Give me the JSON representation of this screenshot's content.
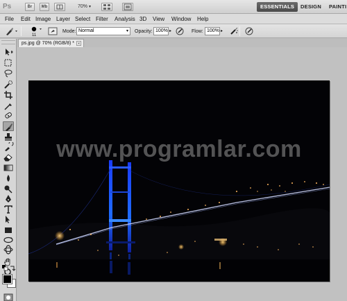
{
  "appbar": {
    "logo": "Ps",
    "br_label": "Br",
    "mb_label": "Mb",
    "zoom": "70%",
    "workspaces": [
      "ESSENTIALS",
      "DESIGN",
      "PAINTI"
    ]
  },
  "menu": [
    "File",
    "Edit",
    "Image",
    "Layer",
    "Select",
    "Filter",
    "Analysis",
    "3D",
    "View",
    "Window",
    "Help"
  ],
  "options": {
    "brush_size": "11",
    "mode_label": "Mode:",
    "mode_value": "Normal",
    "opacity_label": "Opacity:",
    "opacity_value": "100%",
    "flow_label": "Flow:",
    "flow_value": "100%"
  },
  "document": {
    "tab_title": "ps.jpg @ 70% (RGB/8) *",
    "close_glyph": "×"
  },
  "canvas": {
    "watermark": "www.programlar.com"
  },
  "icons": [
    "move-tool-icon",
    "marquee-tool-icon",
    "lasso-tool-icon",
    "quick-selection-tool-icon",
    "crop-tool-icon",
    "eyedropper-tool-icon",
    "healing-brush-tool-icon",
    "brush-tool-icon",
    "clone-stamp-tool-icon",
    "history-brush-tool-icon",
    "eraser-tool-icon",
    "gradient-tool-icon",
    "blur-tool-icon",
    "dodge-tool-icon",
    "pen-tool-icon",
    "type-tool-icon",
    "path-selection-tool-icon",
    "rectangle-tool-icon",
    "3d-rotate-tool-icon",
    "3d-orbit-tool-icon",
    "hand-tool-icon",
    "zoom-tool-icon"
  ],
  "colors": {
    "foreground": "#000000",
    "background": "#ffffff",
    "active_workspace": "#555555"
  }
}
